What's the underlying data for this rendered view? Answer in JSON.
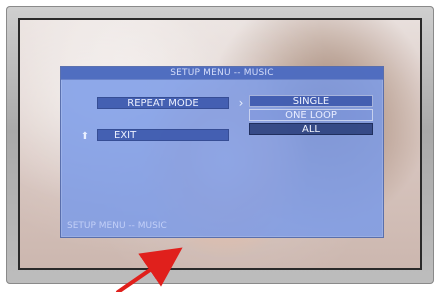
{
  "osd": {
    "header": "SETUP MENU -- MUSIC",
    "menu": {
      "repeat_mode": "REPEAT MODE",
      "exit": "EXIT"
    },
    "options": [
      "SINGLE",
      "ONE LOOP",
      "ALL"
    ],
    "footer": "SETUP MENU -- MUSIC"
  },
  "colors": {
    "annotation_arrow": "#e0201c"
  }
}
